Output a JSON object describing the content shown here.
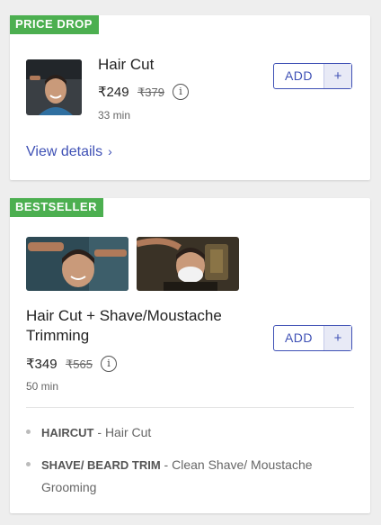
{
  "services": [
    {
      "badge": "PRICE DROP",
      "title": "Hair Cut",
      "price": "₹249",
      "mrp": "₹379",
      "duration": "33 min",
      "add_label": "ADD",
      "add_plus": "+",
      "info_glyph": "i",
      "view_details": "View details",
      "view_details_chevron": "›"
    },
    {
      "badge": "BESTSELLER",
      "title_line1": "Hair Cut + Shave/Moustache",
      "title_line2": "Trimming",
      "price": "₹349",
      "mrp": "₹565",
      "duration": "50 min",
      "add_label": "ADD",
      "add_plus": "+",
      "info_glyph": "i",
      "details": [
        {
          "key": "HAIRCUT",
          "text": " - Hair Cut"
        },
        {
          "key": "SHAVE/ BEARD TRIM",
          "text": " - Clean Shave/ Moustache Grooming"
        }
      ]
    }
  ],
  "colors": {
    "badge": "#4caf50",
    "accent": "#3f51b5",
    "background": "#eeeeee"
  }
}
